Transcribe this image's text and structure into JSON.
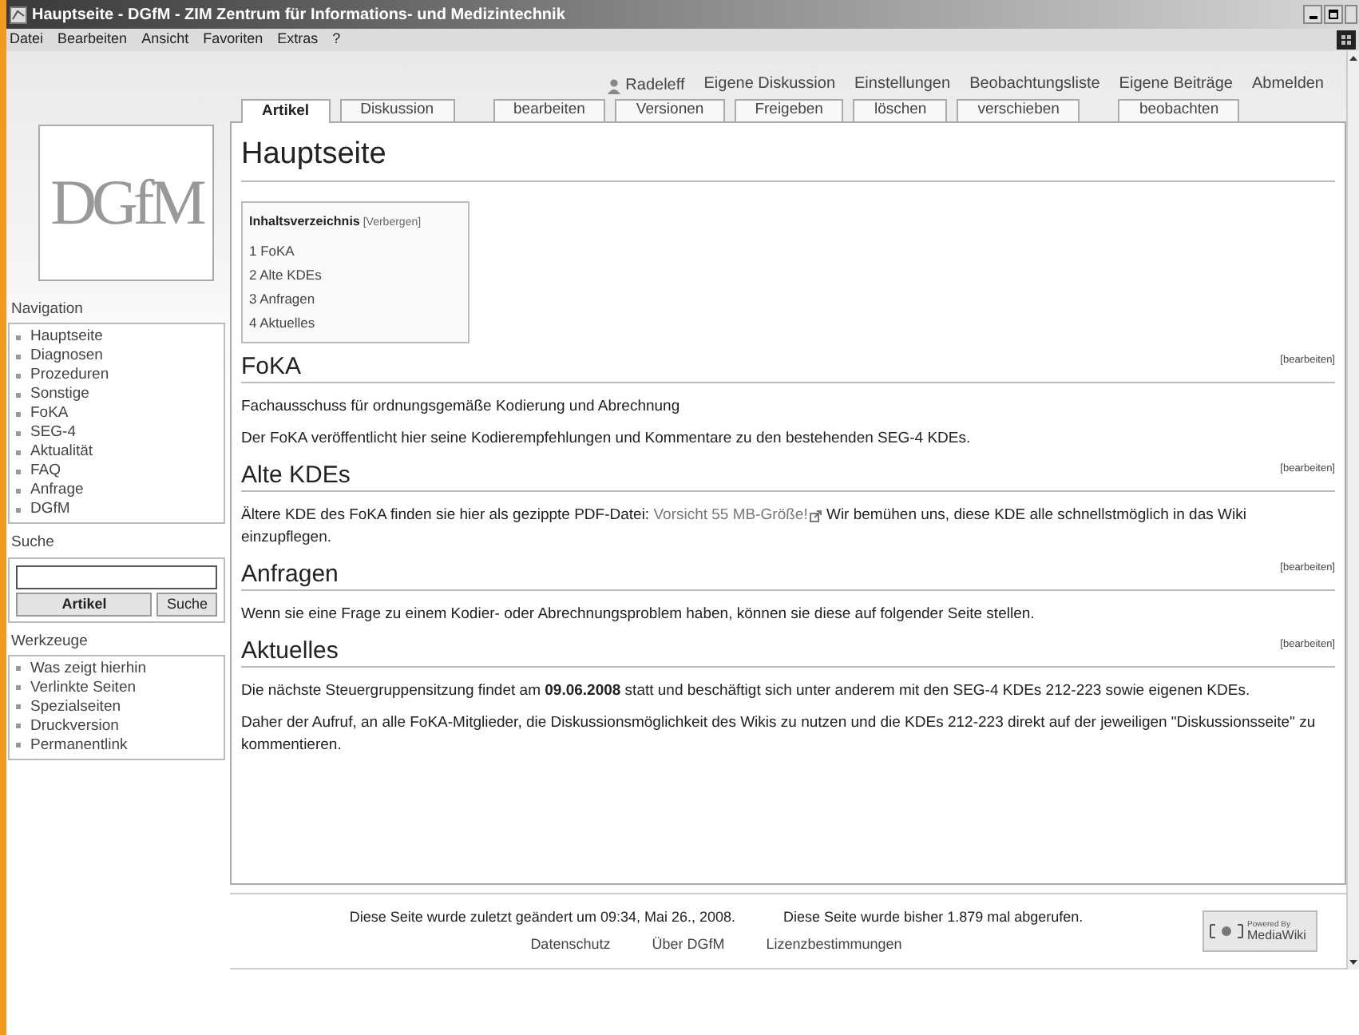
{
  "window": {
    "title": "Hauptseite - DGfM - ZIM Zentrum für Informations- und Medizintechnik"
  },
  "menu": [
    "Datei",
    "Bearbeiten",
    "Ansicht",
    "Favoriten",
    "Extras",
    "?"
  ],
  "personal_links": [
    {
      "label": "Radeleff",
      "kind": "user"
    },
    {
      "label": "Eigene Diskussion",
      "kind": "link"
    },
    {
      "label": "Einstellungen",
      "kind": "link"
    },
    {
      "label": "Beobachtungsliste",
      "kind": "link"
    },
    {
      "label": "Eigene Beiträge",
      "kind": "link"
    },
    {
      "label": "Abmelden",
      "kind": "link"
    }
  ],
  "tabs": [
    {
      "label": "Artikel",
      "selected": true
    },
    {
      "label": "Diskussion",
      "selected": false
    },
    {
      "label": "bearbeiten",
      "selected": false
    },
    {
      "label": "Versionen",
      "selected": false
    },
    {
      "label": "Freigeben",
      "selected": false
    },
    {
      "label": "löschen",
      "selected": false
    },
    {
      "label": "verschieben",
      "selected": false
    },
    {
      "label": "beobachten",
      "selected": false
    }
  ],
  "logo": "DGfM",
  "navigation": {
    "title": "Navigation",
    "items": [
      "Hauptseite",
      "Diagnosen",
      "Prozeduren",
      "Sonstige",
      "FoKA",
      "SEG-4",
      "Aktualität",
      "FAQ",
      "Anfrage",
      "DGfM"
    ]
  },
  "search": {
    "title": "Suche",
    "buttons": [
      "Artikel",
      "Suche"
    ]
  },
  "tools": {
    "title": "Werkzeuge",
    "items": [
      "Was zeigt hierhin",
      "Verlinkte Seiten",
      "Spezialseiten",
      "Druckversion",
      "Permanentlink"
    ]
  },
  "content": {
    "title": "Hauptseite",
    "toc": {
      "title": "Inhaltsverzeichnis",
      "toggle": "[Verbergen]",
      "items": [
        "1 FoKA",
        "2 Alte KDEs",
        "3 Anfragen",
        "4 Aktuelles"
      ]
    },
    "sections": [
      {
        "heading": "FoKA",
        "edit": "[bearbeiten]",
        "paragraphs": [
          [
            {
              "kind": "text",
              "text": "Fachausschuss für ordnungsgemäße Kodierung und Abrechnung"
            }
          ],
          [
            {
              "kind": "text",
              "text": "Der FoKA veröffentlicht hier seine Kodierempfehlungen und Kommentare zu den bestehenden SEG-4 KDEs."
            }
          ]
        ]
      },
      {
        "heading": "Alte KDEs",
        "edit": "[bearbeiten]",
        "paragraphs": [
          [
            {
              "kind": "text",
              "text": "Ältere KDE des FoKA finden sie hier als gezippte PDF-Datei: "
            },
            {
              "kind": "link",
              "text": "Vorsicht 55 MB-Größe!"
            },
            {
              "kind": "text",
              "text": " Wir bemühen uns, diese KDE alle schnellstmöglich in das Wiki einzupflegen."
            }
          ]
        ]
      },
      {
        "heading": "Anfragen",
        "edit": "[bearbeiten]",
        "paragraphs": [
          [
            {
              "kind": "text",
              "text": "Wenn sie eine Frage zu einem Kodier- oder Abrechnungsproblem haben, können sie diese auf folgender Seite stellen."
            }
          ]
        ]
      },
      {
        "heading": "Aktuelles",
        "edit": "[bearbeiten]",
        "paragraphs": [
          [
            {
              "kind": "text",
              "text": "Die nächste Steuergruppensitzung findet am **09.06.2008** statt und beschäftigt sich unter anderem mit den SEG-4 KDEs 212-223 sowie eigenen KDEs."
            }
          ],
          [
            {
              "kind": "text",
              "text": "Daher der Aufruf, an alle FoKA-Mitglieder, die Diskussionsmöglichkeit des Wikis zu nutzen und die KDEs 212-223 direkt auf der jeweiligen \"Diskussionsseite\" zu kommentieren."
            }
          ]
        ]
      }
    ]
  },
  "footer": {
    "modified": "Diese Seite wurde zuletzt geändert um 09:34, Mai 26., 2008.",
    "views": "Diese Seite wurde bisher 1.879 mal abgerufen.",
    "links": [
      "Datenschutz",
      "Über DGfM",
      "Lizenzbestimmungen"
    ],
    "badge": [
      "Powered By",
      "MediaWiki"
    ]
  }
}
